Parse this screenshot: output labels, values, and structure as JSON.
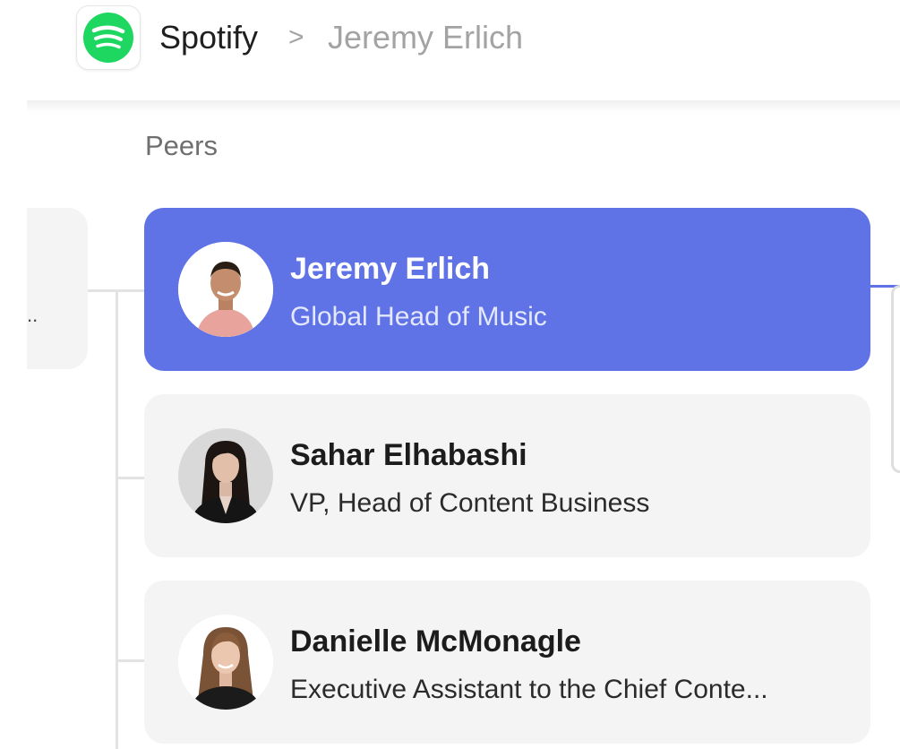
{
  "breadcrumb": {
    "company": "Spotify",
    "separator": ">",
    "person": "Jeremy Erlich"
  },
  "brand": {
    "logo_icon": "spotify-logo-icon",
    "logo_color": "#1ed760",
    "accent_color": "#5f72e6"
  },
  "section": {
    "label": "Peers"
  },
  "left_card": {
    "truncated_text": ".."
  },
  "peers": [
    {
      "name": "Jeremy Erlich",
      "title": "Global Head of Music",
      "active": true
    },
    {
      "name": "Sahar Elhabashi",
      "title": "VP, Head of Content Business",
      "active": false
    },
    {
      "name": "Danielle McMonagle",
      "title": "Executive Assistant to the Chief Conte...",
      "active": false
    }
  ]
}
